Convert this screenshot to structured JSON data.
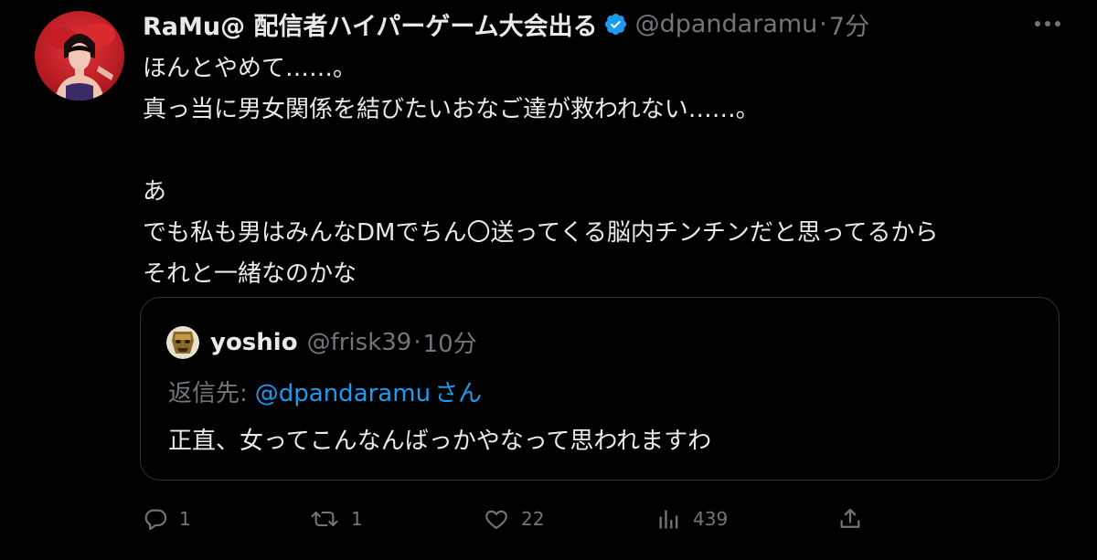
{
  "author": {
    "display_name": "RaMu@ 配信者ハイパーゲーム大会出る",
    "handle": "@dpandaramu",
    "separator": "·",
    "time": "7分",
    "verified": true,
    "avatar_icon": "profile-photo"
  },
  "tweet": {
    "lines": [
      "ほんとやめて……。",
      "真っ当に男女関係を結びたいおなご達が救われない……。",
      "",
      "あ",
      "でも私も男はみんなDMでちん〇送ってくる脳内チンチンだと思ってるから",
      "それと一緒なのかな"
    ]
  },
  "quote": {
    "display_name": "yoshio",
    "handle": "@frisk39",
    "separator": "·",
    "time": "10分",
    "reply_label": "返信先:",
    "reply_mention": "@dpandaramu",
    "reply_suffix": "さん",
    "text": "正直、女ってこんなんばっかやなって思われますわ"
  },
  "actions": {
    "reply_count": "1",
    "retweet_count": "1",
    "like_count": "22",
    "views_count": "439"
  },
  "colors": {
    "background": "#000000",
    "text": "#e7e9ea",
    "muted": "#71767b",
    "accent": "#1d9bf0",
    "border": "#2f3336"
  }
}
